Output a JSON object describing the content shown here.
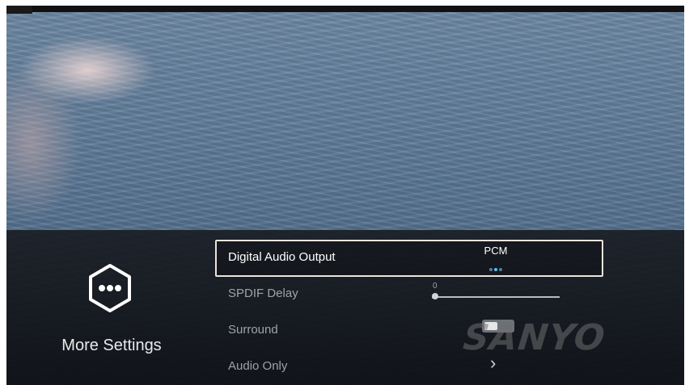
{
  "panel": {
    "title": "More Settings",
    "icon": "more-dots-icon"
  },
  "settings": [
    {
      "label": "Digital Audio Output",
      "value": "PCM",
      "option_count": 3,
      "selected_option_index": 1
    },
    {
      "label": "SPDIF Delay",
      "value": "0",
      "level_fraction": 0.0
    },
    {
      "label": "Surround",
      "state": "off"
    },
    {
      "label": "Audio Only",
      "icon": "chevron-right-icon"
    }
  ],
  "brand": {
    "text": "SANYO"
  },
  "colors": {
    "focus_border": "#e9e4dc",
    "accent": "#4fc3ff",
    "panel_bg": "#15181e"
  }
}
